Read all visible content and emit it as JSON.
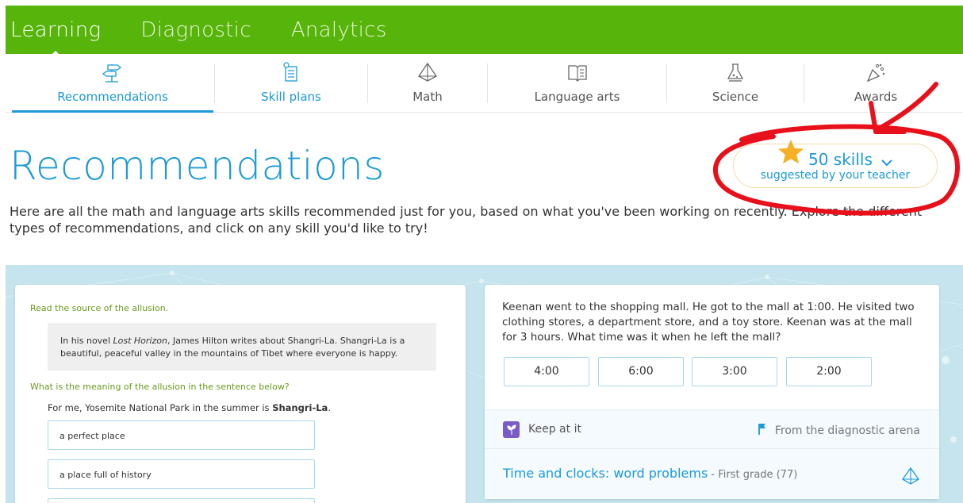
{
  "top_nav": {
    "items": [
      "Learning",
      "Diagnostic",
      "Analytics"
    ],
    "active": "Learning"
  },
  "sub_nav": {
    "items": [
      {
        "label": "Recommendations",
        "icon": "signpost-icon"
      },
      {
        "label": "Skill plans",
        "icon": "skill-plan-icon"
      },
      {
        "label": "Math",
        "icon": "pyramid-icon"
      },
      {
        "label": "Language arts",
        "icon": "book-icon"
      },
      {
        "label": "Science",
        "icon": "flask-icon"
      },
      {
        "label": "Awards",
        "icon": "party-popper-icon"
      }
    ],
    "active": "Recommendations"
  },
  "page": {
    "title": "Recommendations",
    "intro": "Here are all the math and language arts skills recommended just for you, based on what you've been working on recently. Explore the different types of recommendations, and click on any skill you'd like to try!"
  },
  "skills_badge": {
    "count_label": "50 skills",
    "subtitle": "suggested by your teacher",
    "icon": "star-icon"
  },
  "left_card": {
    "prompt1": "Read the source of the allusion.",
    "quote_pre": "In his novel ",
    "quote_title": "Lost Horizon",
    "quote_post": ", James Hilton writes about Shangri-La. Shangri-La is a beautiful, peaceful valley in the mountains of Tibet where everyone is happy.",
    "prompt2": "What is the meaning of the allusion in the sentence below?",
    "sentence_pre": "For me, Yosemite National Park in the summer is ",
    "sentence_bold": "Shangri-La",
    "sentence_post": ".",
    "choices": [
      "a perfect place",
      "a place full of history",
      ""
    ]
  },
  "right_card": {
    "problem": "Keenan went to the shopping mall. He got to the mall at 1:00. He visited two clothing stores, a department store, and a toy store. Keenan was at the mall for 3 hours. What time was it when he left the mall?",
    "answers": [
      "4:00",
      "6:00",
      "3:00",
      "2:00"
    ],
    "tag": "Keep at it",
    "source": "From the diagnostic arena",
    "skill_name": "Time and clocks: word problems",
    "skill_grade": " - First grade (77)"
  },
  "colors": {
    "brand_green": "#56b40a",
    "accent_blue": "#1d9ad6",
    "panel_teal": "#c5e4ee",
    "annotation_red": "#e8101a",
    "star_gold": "#f5b025"
  }
}
